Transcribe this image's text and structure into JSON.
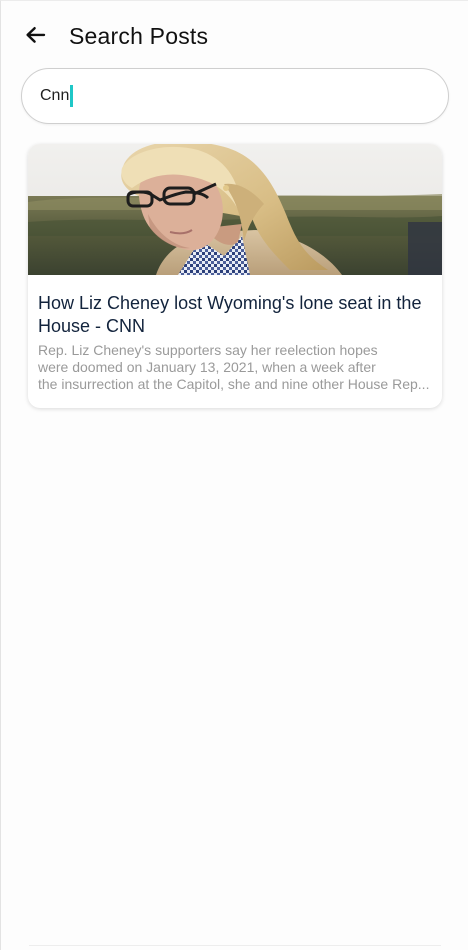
{
  "header": {
    "title": "Search Posts",
    "back_icon": "arrow-left-icon"
  },
  "search": {
    "value": "Cnn",
    "caret_color": "#1fc7c7"
  },
  "results": [
    {
      "title": "How Liz Cheney lost Wyoming's lone seat in the House - CNN",
      "snippet_lines": [
        "Rep. Liz Cheney's supporters say her reelection hopes",
        "were doomed on January 13, 2021, when a week after",
        "the insurrection at the Capitol, she and nine other House Rep..."
      ],
      "image": "news-photo"
    }
  ],
  "colors": {
    "title_text": "#12233c",
    "snippet_text": "#9a9a9a",
    "background": "#fdfdfd"
  }
}
